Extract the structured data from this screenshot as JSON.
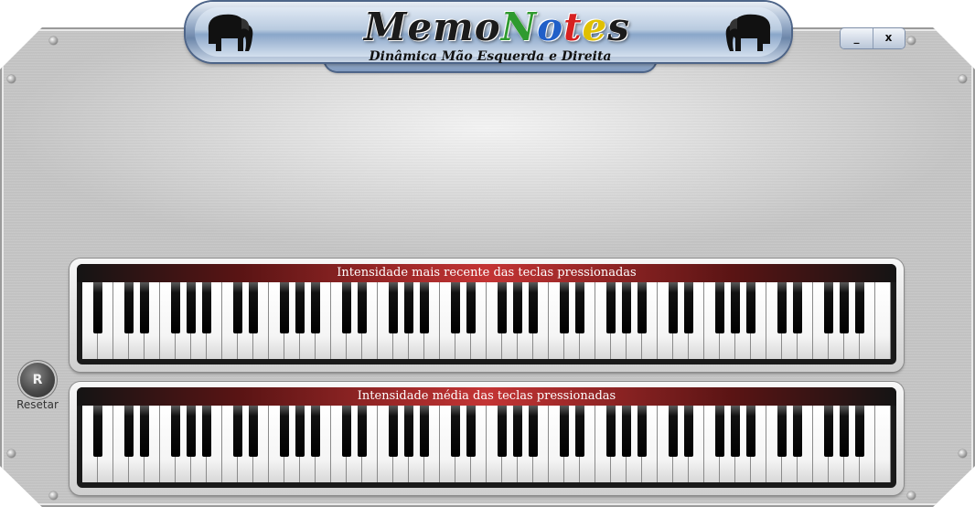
{
  "window": {
    "minimize_label": "_",
    "close_label": "x"
  },
  "title": {
    "logo_letters": [
      "M",
      "e",
      "m",
      "o",
      "N",
      "o",
      "t",
      "e",
      "s"
    ],
    "logo_colors": [
      "#1b1b1b",
      "#1b1b1b",
      "#1b1b1b",
      "#1b1b1b",
      "#2f9a2f",
      "#1f5fc8",
      "#d72020",
      "#e0c000",
      "#1b1b1b"
    ],
    "tagline": "Dinâmica Mão Esquerda e Direita"
  },
  "reset": {
    "button_label": "R",
    "caption": "Resetar"
  },
  "keyboards": {
    "recent": {
      "label": "Intensidade mais recente das teclas pressionadas"
    },
    "average": {
      "label": "Intensidade média das teclas pressionadas"
    },
    "white_key_count": 52
  },
  "colors": {
    "plaque_border": "#4d6488",
    "label_accent": "#c43434"
  },
  "icons": {
    "elephant": "elephant-icon",
    "screw": "screw-icon"
  }
}
